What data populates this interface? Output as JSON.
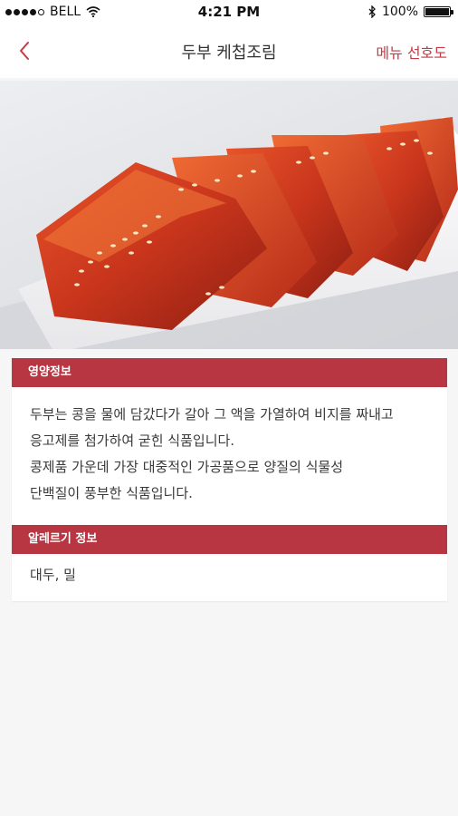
{
  "status_bar": {
    "carrier": "BELL",
    "time": "4:21 PM",
    "battery": "100%",
    "battery_level": 1.0,
    "signal_bars": 4
  },
  "nav": {
    "title": "두부 케첩조림",
    "action_label": "메뉴 선호도",
    "back_icon": "chevron-left-icon"
  },
  "nutrition": {
    "header": "영양정보",
    "lines": [
      "두부는 콩을 물에 담갔다가 갈아 그 액을 가열하여 비지를 짜내고",
      "응고제를 첨가하여 굳힌 식품입니다.",
      "콩제품 가운데 가장 대중적인 가공품으로 양질의 식물성",
      "단백질이 풍부한 식품입니다."
    ]
  },
  "allergy": {
    "header": "알레르기 정보",
    "text": "대두, 밀"
  },
  "colors": {
    "accent": "#c53a46",
    "header_bg": "#b83641",
    "page_bg": "#f6f6f6"
  }
}
